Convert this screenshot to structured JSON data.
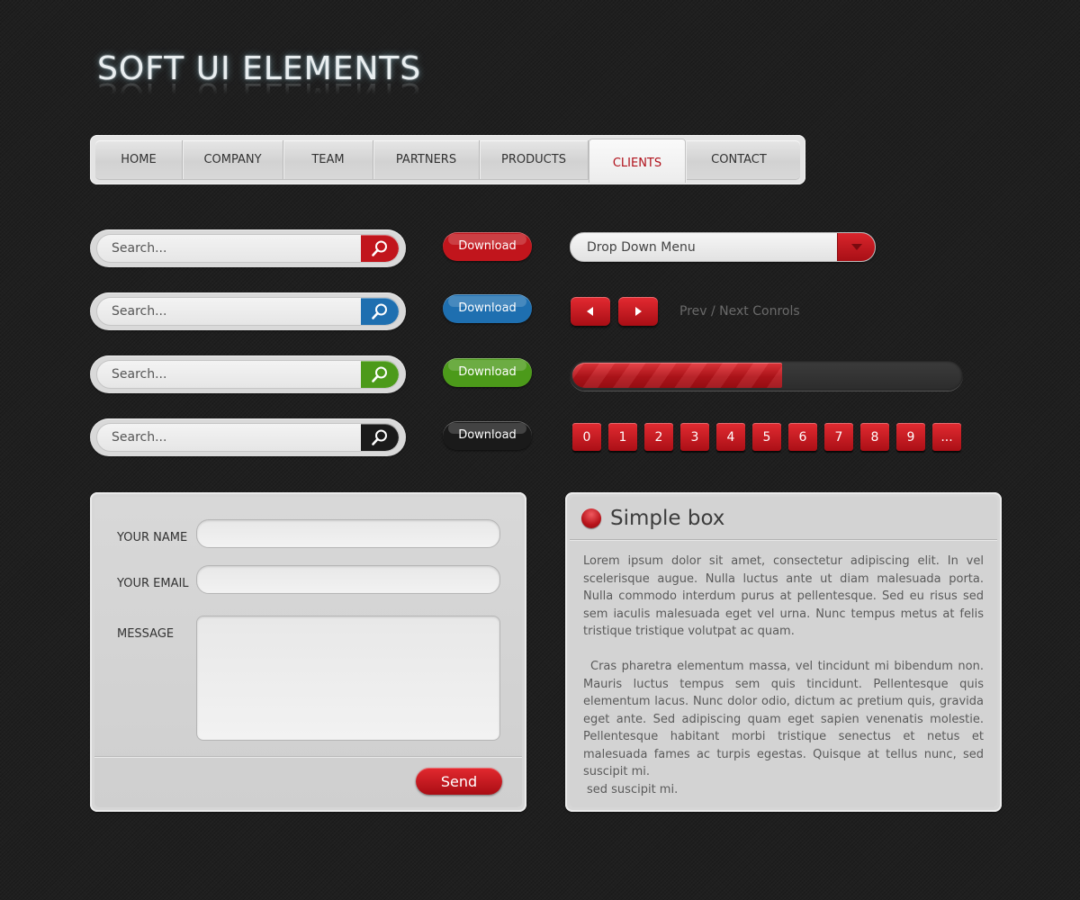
{
  "title": "SOFT UI ELEMENTS",
  "nav": {
    "items": [
      {
        "label": "HOME"
      },
      {
        "label": "COMPANY"
      },
      {
        "label": "TEAM"
      },
      {
        "label": "PARTNERS"
      },
      {
        "label": "PRODUCTS"
      },
      {
        "label": "CLIENTS",
        "active": true
      },
      {
        "label": "CONTACT"
      }
    ]
  },
  "search": {
    "placeholder": "Search...",
    "variants": [
      {
        "color": "#c1151c",
        "icon": "magnifier-icon"
      },
      {
        "color": "#1e6fb0",
        "icon": "magnifier-icon"
      },
      {
        "color": "#4c9a1a",
        "icon": "magnifier-icon"
      },
      {
        "color": "#1a1a1a",
        "icon": "magnifier-icon"
      }
    ]
  },
  "download": {
    "label": "Download",
    "colors": [
      "#c1151c",
      "#1e6fb0",
      "#4c9a1a",
      "#1a1a1a"
    ]
  },
  "dropdown": {
    "label": "Drop Down Menu",
    "icon": "caret-down-icon"
  },
  "prev_next": {
    "label": "Prev / Next Conrols",
    "prev_icon": "triangle-left-icon",
    "next_icon": "triangle-right-icon"
  },
  "progress": {
    "value_percent": 54,
    "color": "#c8181f"
  },
  "pagination": {
    "pages": [
      "0",
      "1",
      "2",
      "3",
      "4",
      "5",
      "6",
      "7",
      "8",
      "9",
      "..."
    ]
  },
  "form": {
    "name_label": "YOUR NAME",
    "email_label": "YOUR EMAIL",
    "message_label": "MESSAGE",
    "send_label": "Send"
  },
  "simple_box": {
    "title": "Simple box",
    "paragraph1": "Lorem ipsum dolor sit amet, consectetur adipiscing elit. In vel scelerisque augue. Nulla luctus ante ut diam malesuada porta. Nulla commodo interdum purus at pellentesque. Sed eu risus sed sem iaculis malesuada eget vel urna. Nunc tempus metus at felis tristique tristique volutpat ac quam.",
    "paragraph2": "Cras pharetra elementum massa, vel tincidunt mi bibendum non. Mauris luctus tempus sem quis tincidunt. Pellentesque quis elementum lacus. Nunc dolor odio, dictum ac pretium quis, gravida eget ante. Sed adipiscing quam eget sapien venenatis molestie. Pellentesque habitant morbi tristique senectus et netus et malesuada fames ac turpis egestas. Quisque at tellus nunc, sed suscipit mi.",
    "paragraph3": "sed suscipit mi."
  }
}
